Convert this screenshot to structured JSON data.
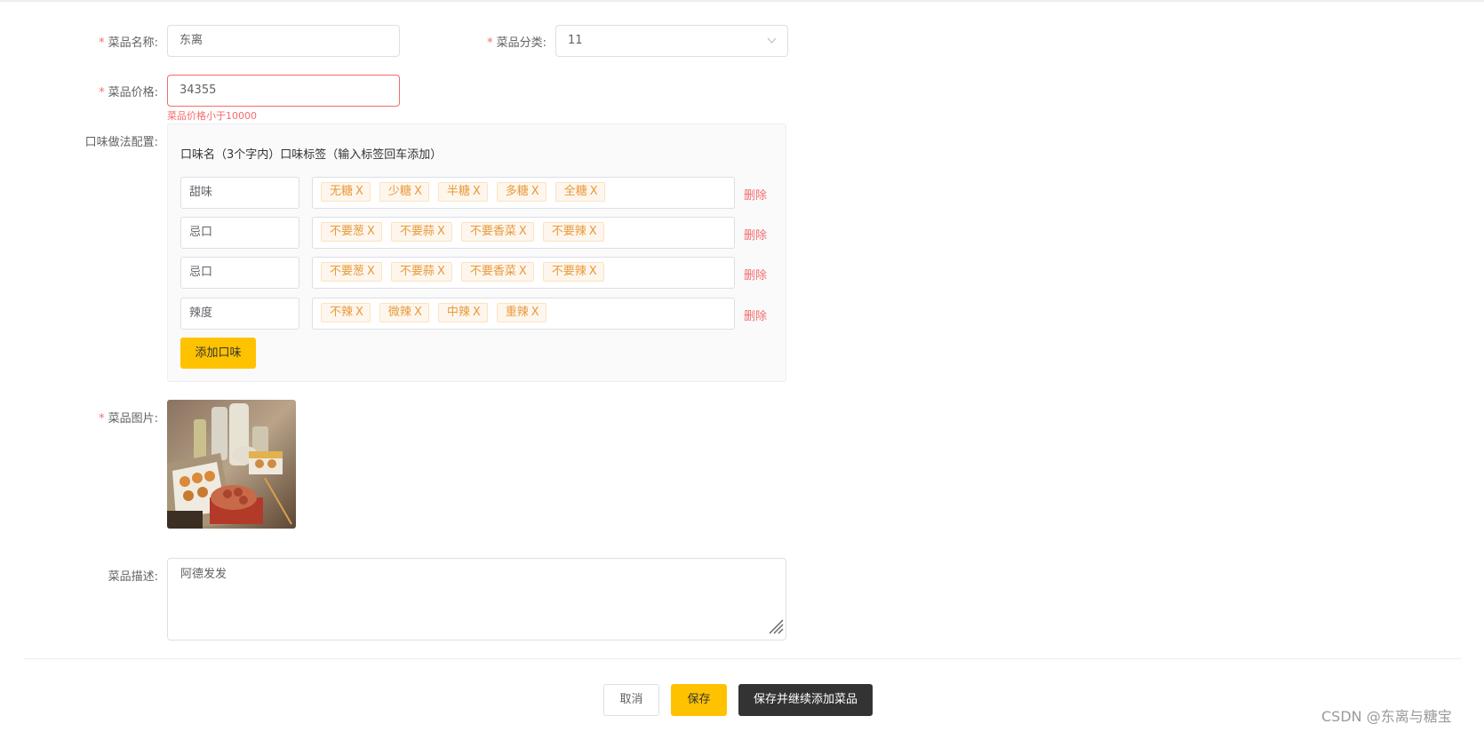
{
  "form": {
    "name": {
      "label": "菜品名称:",
      "value": "东离"
    },
    "category": {
      "label": "菜品分类:",
      "value": "11"
    },
    "price": {
      "label": "菜品价格:",
      "value": "34355",
      "error": "菜品价格小于10000"
    },
    "flavor_config": {
      "label": "口味做法配置:",
      "header": "口味名（3个字内）口味标签（输入标签回车添加）",
      "rows": [
        {
          "name": "甜味",
          "tags": [
            "无糖",
            "少糖",
            "半糖",
            "多糖",
            "全糖"
          ],
          "delete_label": "删除"
        },
        {
          "name": "忌口",
          "tags": [
            "不要葱",
            "不要蒜",
            "不要香菜",
            "不要辣"
          ],
          "delete_label": "删除"
        },
        {
          "name": "忌口",
          "tags": [
            "不要葱",
            "不要蒜",
            "不要香菜",
            "不要辣"
          ],
          "delete_label": "删除"
        },
        {
          "name": "辣度",
          "tags": [
            "不辣",
            "微辣",
            "中辣",
            "重辣"
          ],
          "delete_label": "删除"
        }
      ],
      "tag_remove_glyph": "X",
      "add_button": "添加口味"
    },
    "image": {
      "label": "菜品图片:"
    },
    "description": {
      "label": "菜品描述:",
      "value": "阿德发发"
    }
  },
  "actions": {
    "cancel": "取消",
    "save": "保存",
    "save_continue": "保存并继续添加菜品"
  },
  "watermark": "CSDN @东离与糖宝",
  "colors": {
    "required": "#f56c6c",
    "accent": "#ffc200",
    "dark_button": "#333333",
    "tag_text": "#e89a3c"
  }
}
